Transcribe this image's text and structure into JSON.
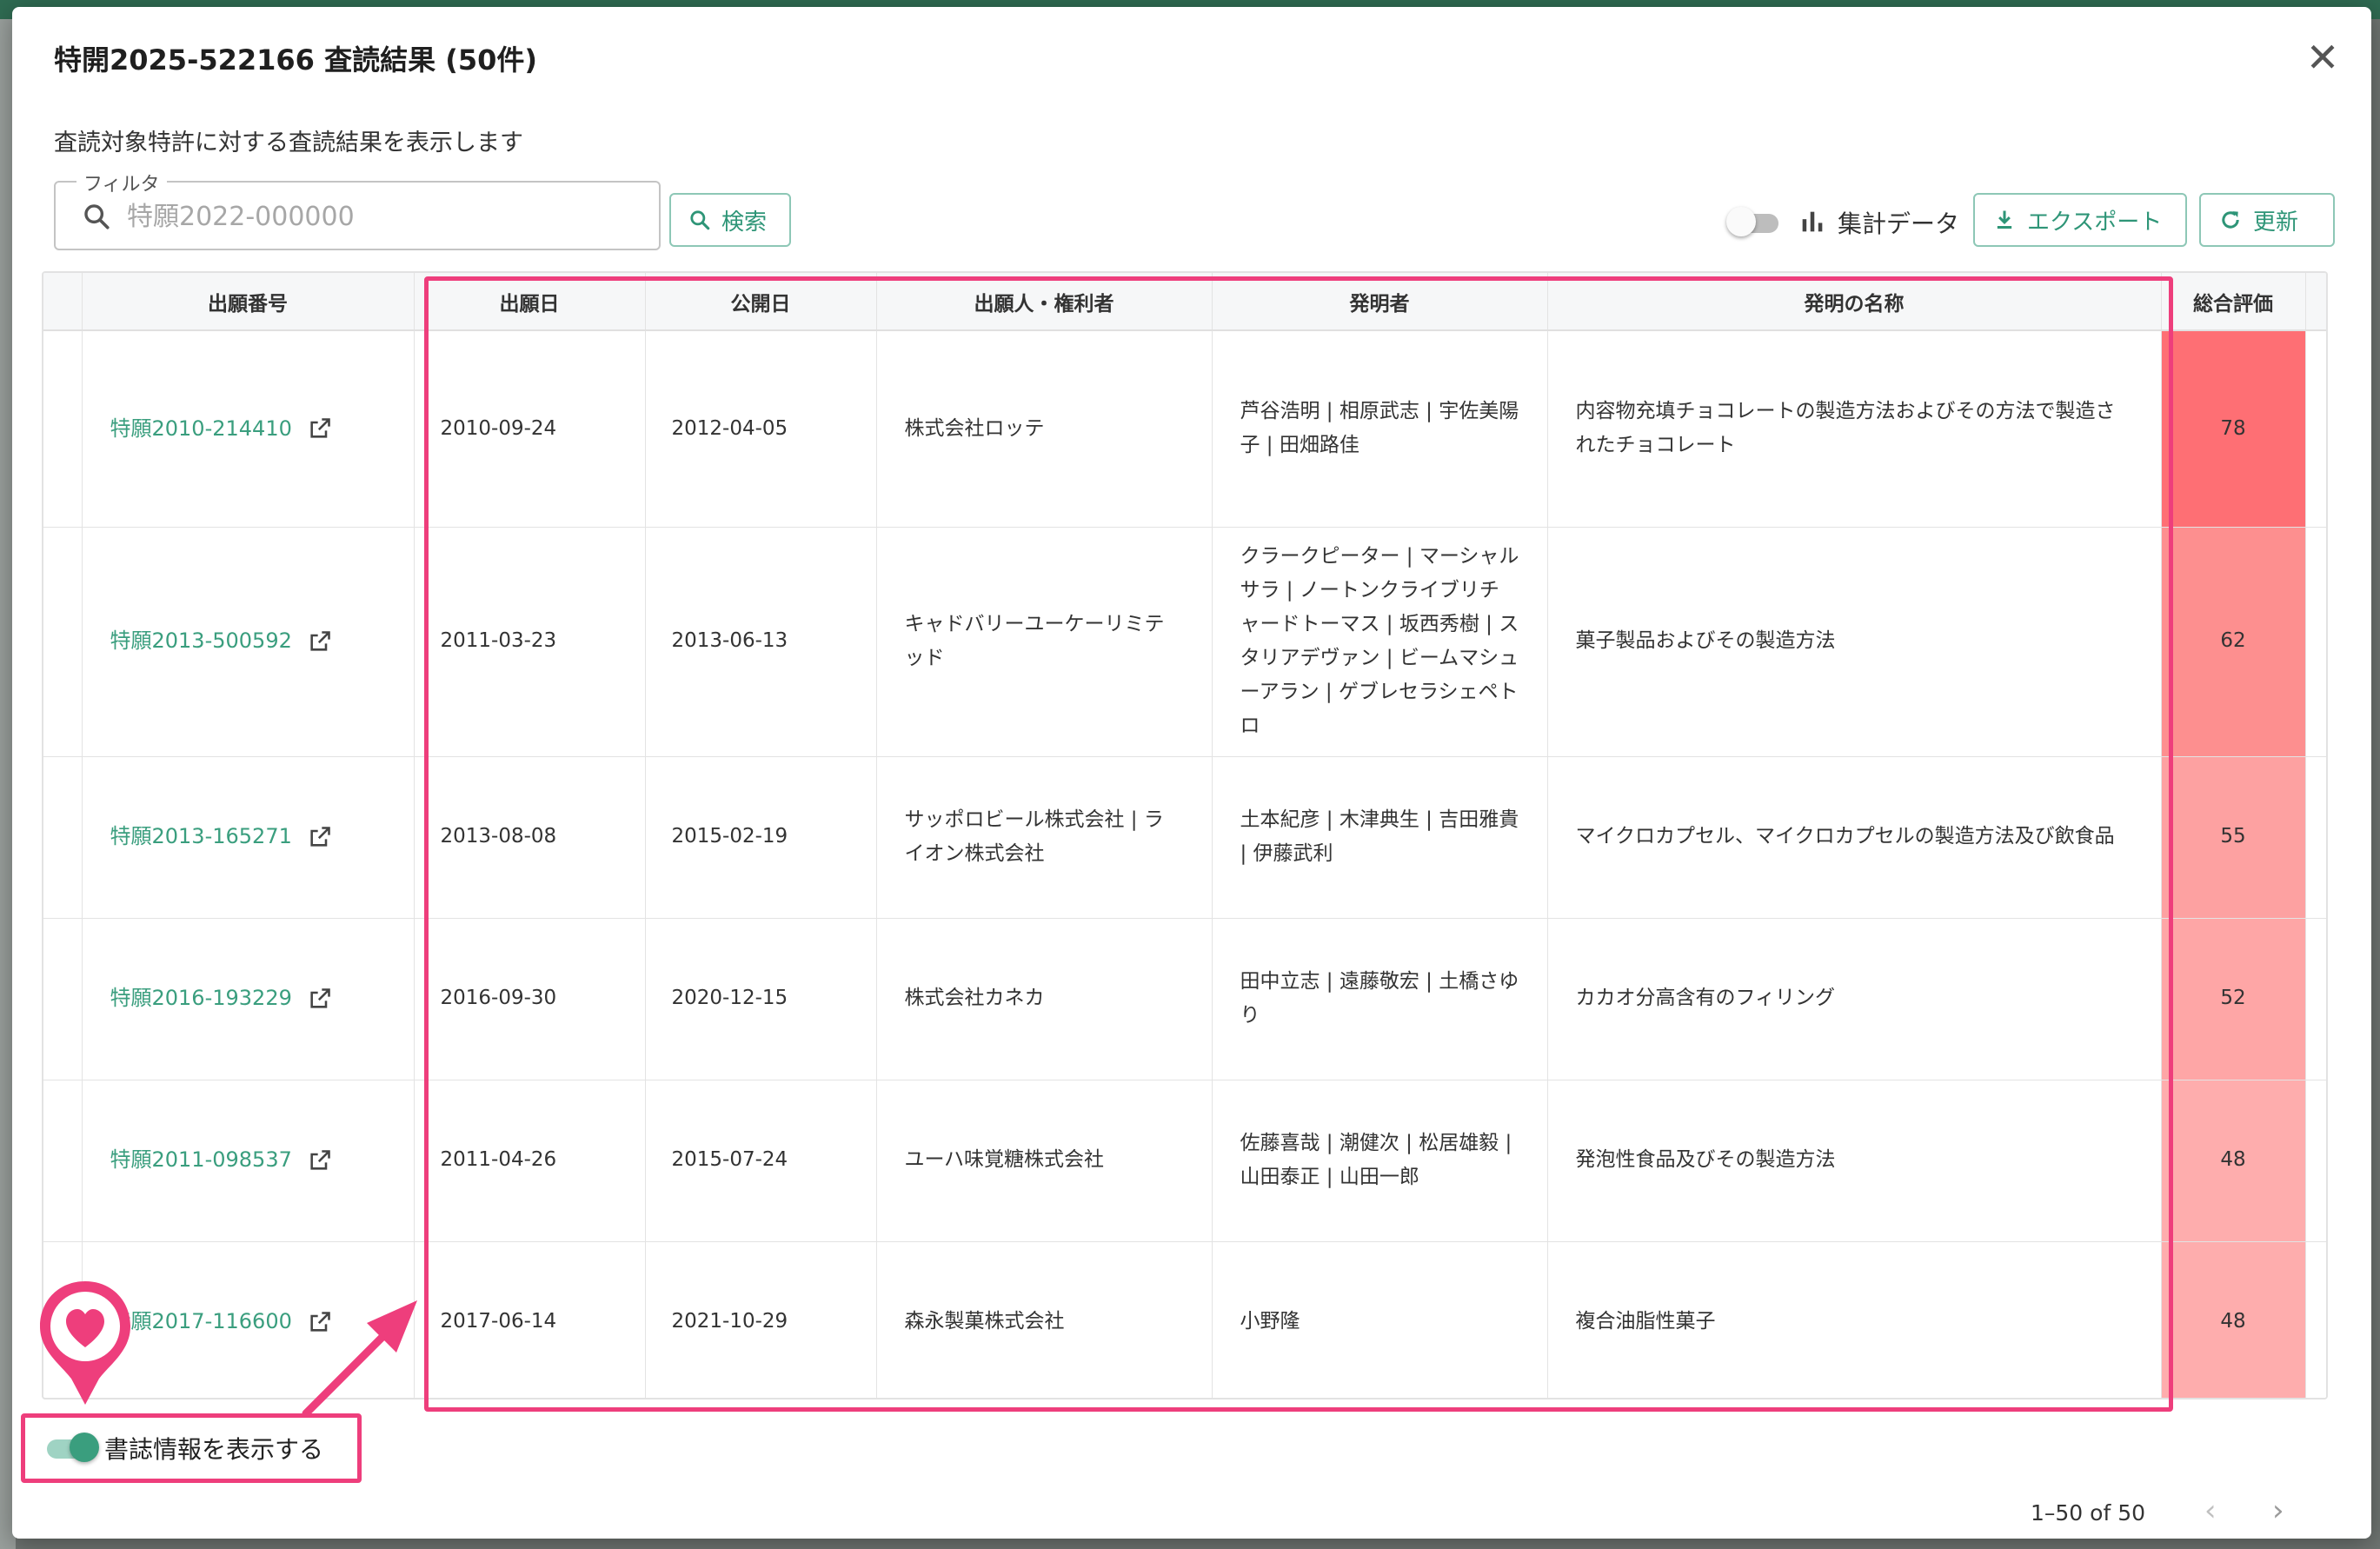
{
  "modal": {
    "title": "特開2025-522166 査読結果 (50件)",
    "subtitle": "査読対象特許に対する査読結果を表示します",
    "close_glyph": "✕"
  },
  "filter": {
    "legend": "フィルタ",
    "placeholder": "特願2022-000000",
    "value": ""
  },
  "toolbar": {
    "search_label": "検索",
    "aggregate_label": "集計データ",
    "aggregate_on": false,
    "export_label": "エクスポート",
    "refresh_label": "更新"
  },
  "table": {
    "columns": [
      "出願番号",
      "出願日",
      "公開日",
      "出願人・権利者",
      "発明者",
      "発明の名称",
      "総合評価"
    ],
    "rows": [
      {
        "app_no": "特願2010-214410",
        "filed": "2010-09-24",
        "published": "2012-04-05",
        "applicant": "株式会社ロッテ",
        "inventors": "芦谷浩明 | 相原武志 | 宇佐美陽子 | 田畑路佳",
        "title": "内容物充填チョコレートの製造方法およびその方法で製造されたチョコレート",
        "score": 78
      },
      {
        "app_no": "特願2013-500592",
        "filed": "2011-03-23",
        "published": "2013-06-13",
        "applicant": "キャドバリーユーケーリミテッド",
        "inventors": "クラークピーター | マーシャルサラ | ノートンクライブリチャードトーマス | 坂西秀樹 | スタリアデヴァン | ビームマシューアラン | ゲブレセラシェペトロ",
        "title": "菓子製品およびその製造方法",
        "score": 62
      },
      {
        "app_no": "特願2013-165271",
        "filed": "2013-08-08",
        "published": "2015-02-19",
        "applicant": "サッポロビール株式会社 | ライオン株式会社",
        "inventors": "土本紀彦 | 木津典生 | 吉田雅貴 | 伊藤武利",
        "title": "マイクロカプセル、マイクロカプセルの製造方法及び飲食品",
        "score": 55
      },
      {
        "app_no": "特願2016-193229",
        "filed": "2016-09-30",
        "published": "2020-12-15",
        "applicant": "株式会社カネカ",
        "inventors": "田中立志 | 遠藤敬宏 | 土橋さゆり",
        "title": "カカオ分高含有のフィリング",
        "score": 52
      },
      {
        "app_no": "特願2011-098537",
        "filed": "2011-04-26",
        "published": "2015-07-24",
        "applicant": "ユーハ味覚糖株式会社",
        "inventors": "佐藤喜哉 | 潮健次 | 松居雄毅 | 山田泰正 | 山田一郎",
        "title": "発泡性食品及びその製造方法",
        "score": 48
      },
      {
        "app_no": "特願2017-116600",
        "filed": "2017-06-14",
        "published": "2021-10-29",
        "applicant": "森永製菓株式会社",
        "inventors": "小野隆",
        "title": "複合油脂性菓子",
        "score": 48
      }
    ]
  },
  "score_colors": {
    "78": "#fe6f74",
    "62": "#fd8f8f",
    "55": "#fda1a1",
    "52": "#fea6a6",
    "48": "#fead ad"
  },
  "footer": {
    "biblio_label": "書誌情報を表示する",
    "biblio_on": true,
    "pagination": "1–50 of 50",
    "prev_glyph": "‹",
    "next_glyph": "›"
  },
  "colors": {
    "accent": "#3a9e7e",
    "highlight": "#ee3e7c"
  }
}
